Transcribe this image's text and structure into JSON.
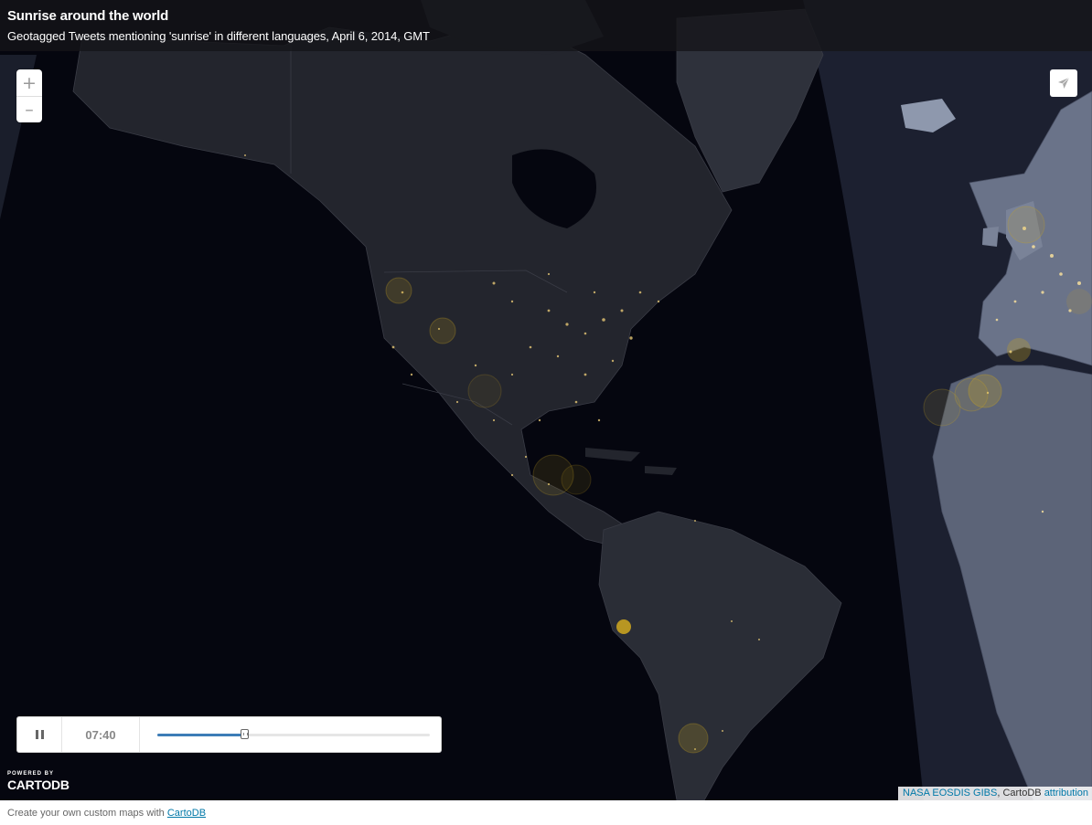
{
  "header": {
    "title": "Sunrise around the world",
    "subtitle": "Geotagged Tweets mentioning 'sunrise' in different languages, April 6, 2014, GMT"
  },
  "zoom": {
    "in_label": "+",
    "out_label": "–"
  },
  "share": {
    "icon": "paper-plane-icon"
  },
  "timeslider": {
    "state": "playing",
    "pause_icon": "pause-icon",
    "time": "07:40",
    "progress": 0.32
  },
  "powered": {
    "line1": "POWERED BY",
    "line2": "CARTODB"
  },
  "attribution": {
    "link1": "NASA EOSDIS GIBS",
    "separator": ", CartoDB ",
    "link2": "attribution"
  },
  "footer": {
    "text": "Create your own custom maps with ",
    "link": "CartoDB"
  },
  "colors": {
    "night": "#05060f",
    "land_night": "#23252d",
    "day_side": "#454d63",
    "city_lights": "#f3d27a",
    "tweet_marker": "#c8a220",
    "slider_fill": "#3d7db7"
  }
}
